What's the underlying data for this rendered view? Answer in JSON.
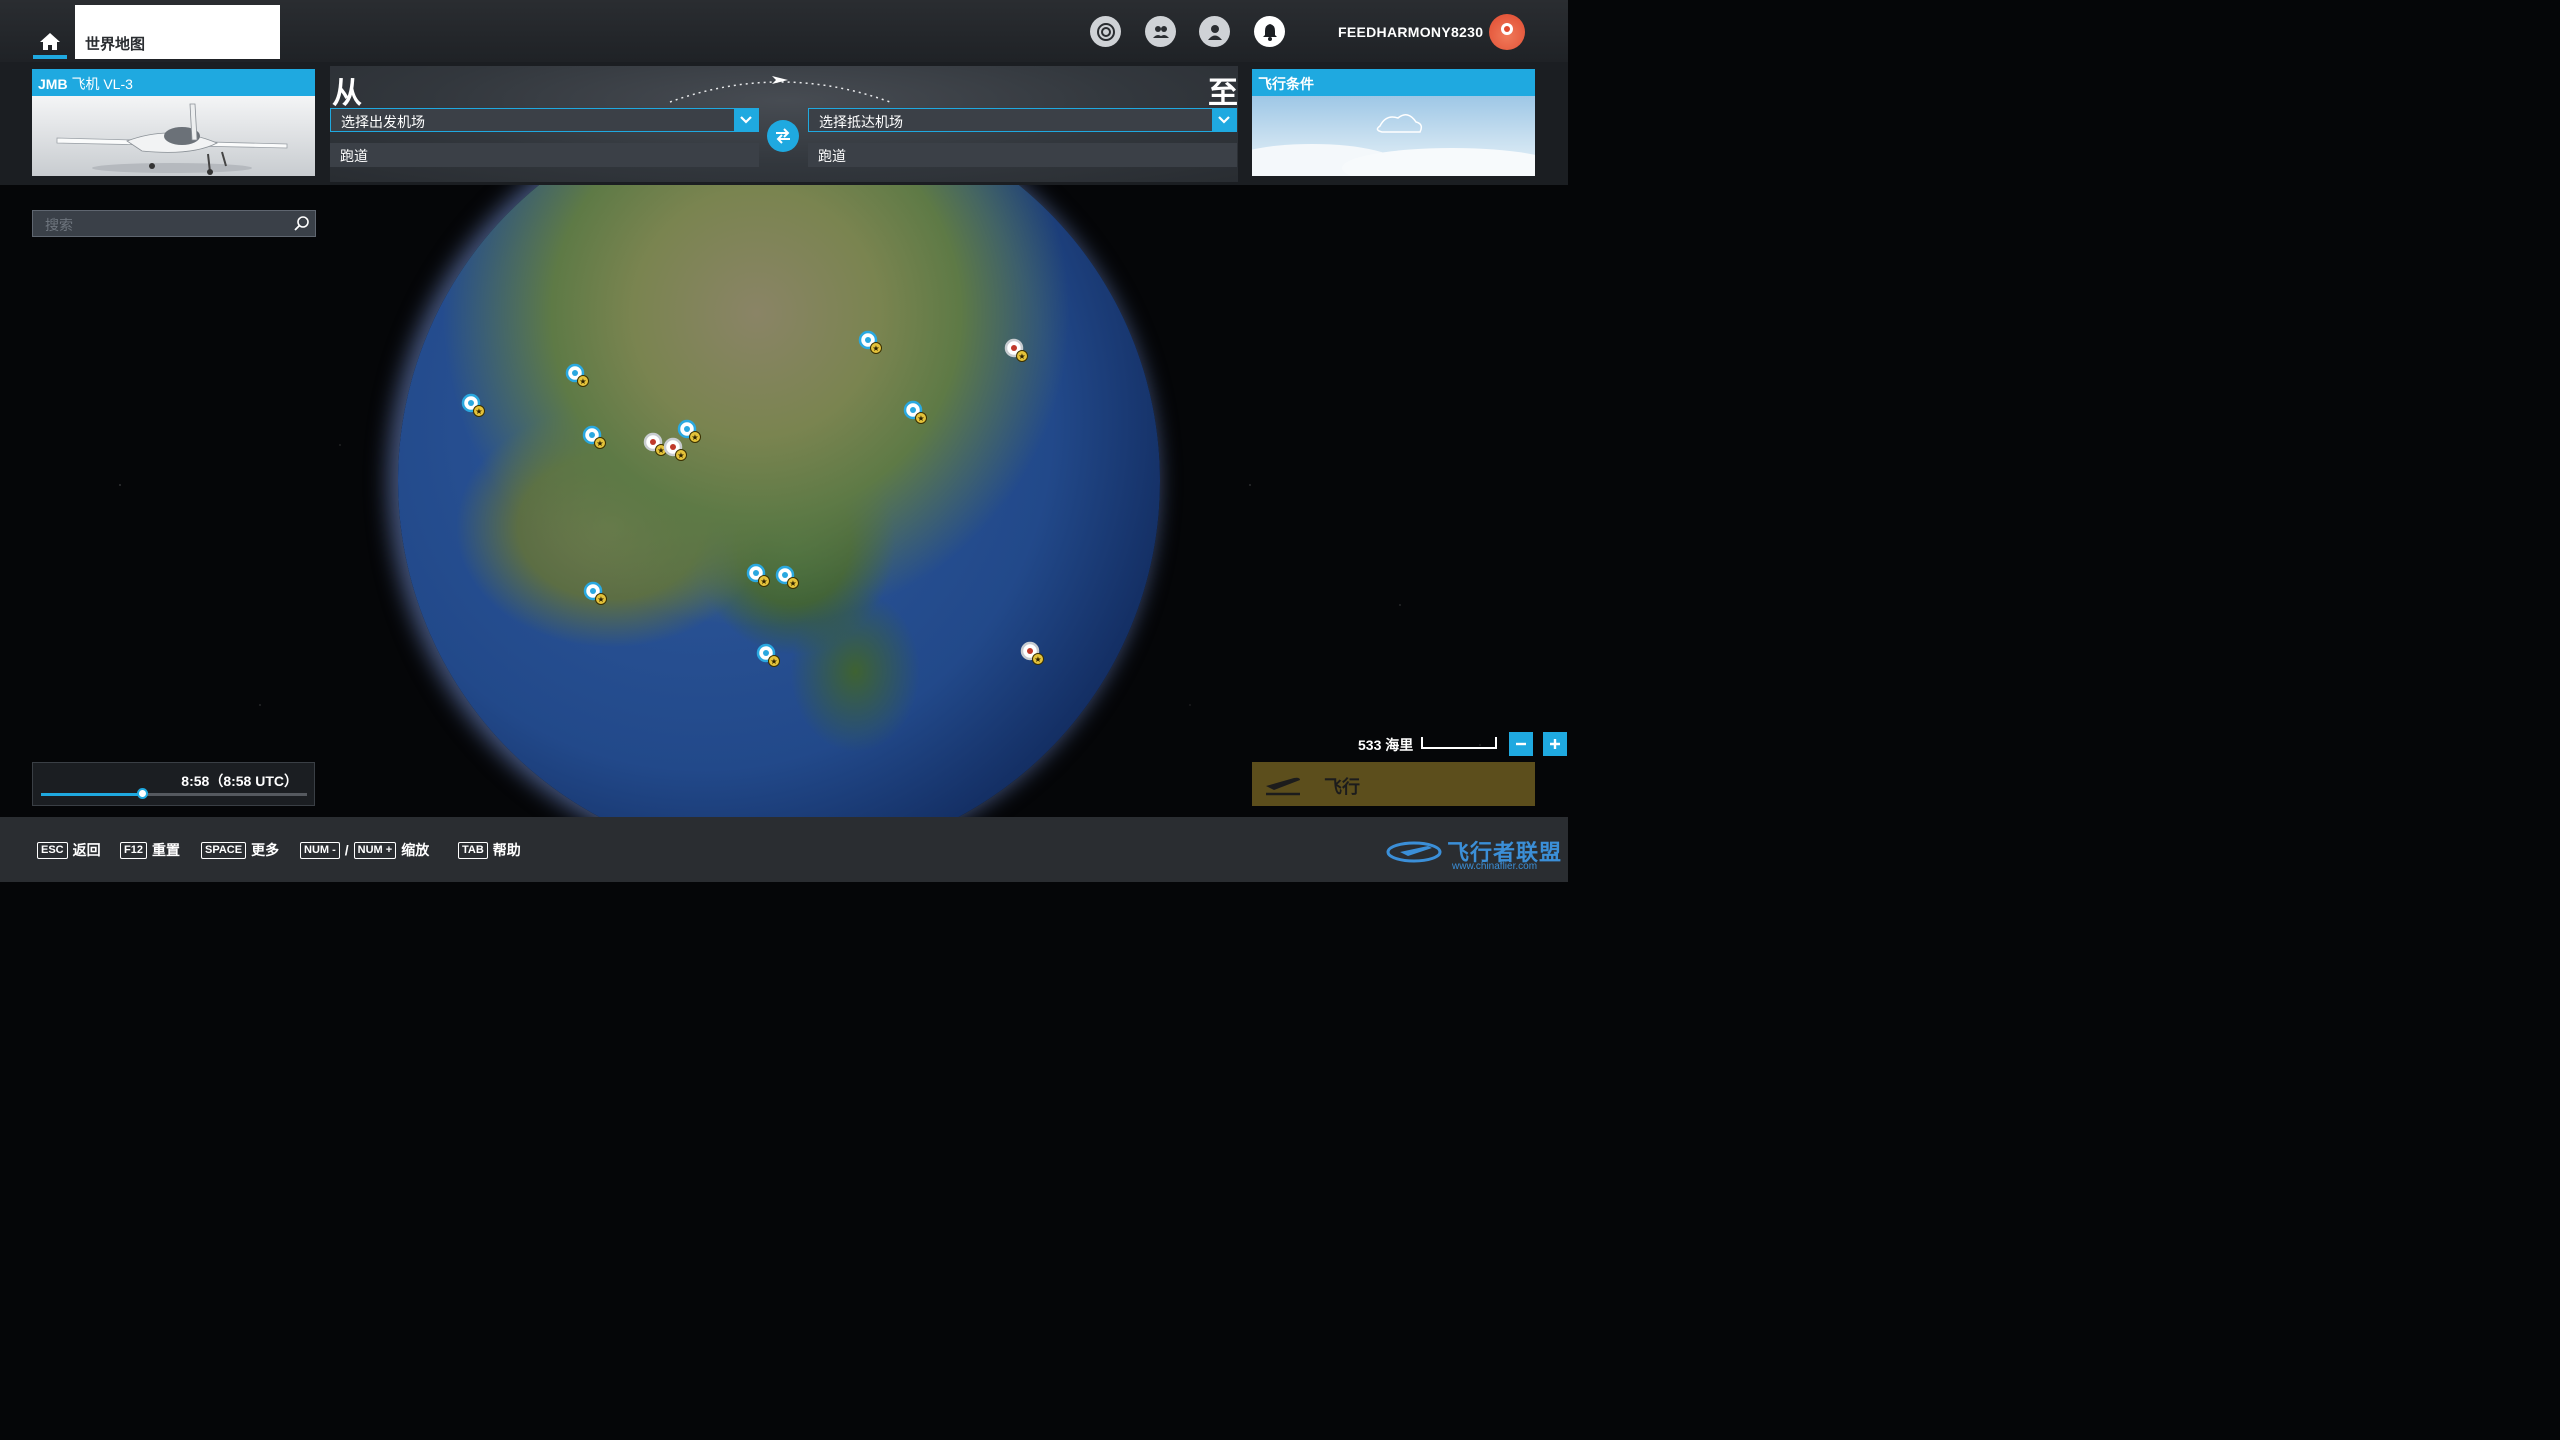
{
  "topnav": {
    "tab_worldmap": "世界地图",
    "username": "FEEDHARMONY8230",
    "icons": [
      "home-icon",
      "activity-icon",
      "friends-icon",
      "profile-icon",
      "bell-icon"
    ]
  },
  "aircraft": {
    "brand": "JMB",
    "type": "飞机",
    "model": "VL-3"
  },
  "route": {
    "from_label": "从",
    "to_label": "至",
    "departure_placeholder": "选择出发机场",
    "arrival_placeholder": "选择抵达机场",
    "runway_from": "跑道",
    "runway_to": "跑道"
  },
  "conditions": {
    "title": "飞行条件"
  },
  "search": {
    "placeholder": "搜索"
  },
  "time": {
    "display": "8:58（8:58 UTC）",
    "progress": 0.38
  },
  "scale": {
    "label": "533 海里"
  },
  "fly_button": {
    "label": "飞行"
  },
  "hints": [
    {
      "key": "ESC",
      "label": "返回"
    },
    {
      "key": "F12",
      "label": "重置"
    },
    {
      "key": "SPACE",
      "label": "更多"
    },
    {
      "key": "NUM -",
      "sep": "/",
      "key2": "NUM +",
      "label": "缩放"
    },
    {
      "key": "TAB",
      "label": "帮助"
    }
  ],
  "watermark": {
    "name": "飞行者联盟",
    "url": "www.chinaflier.com"
  },
  "colors": {
    "accent": "#1fa9e0",
    "fly": "#5c4e1c"
  }
}
